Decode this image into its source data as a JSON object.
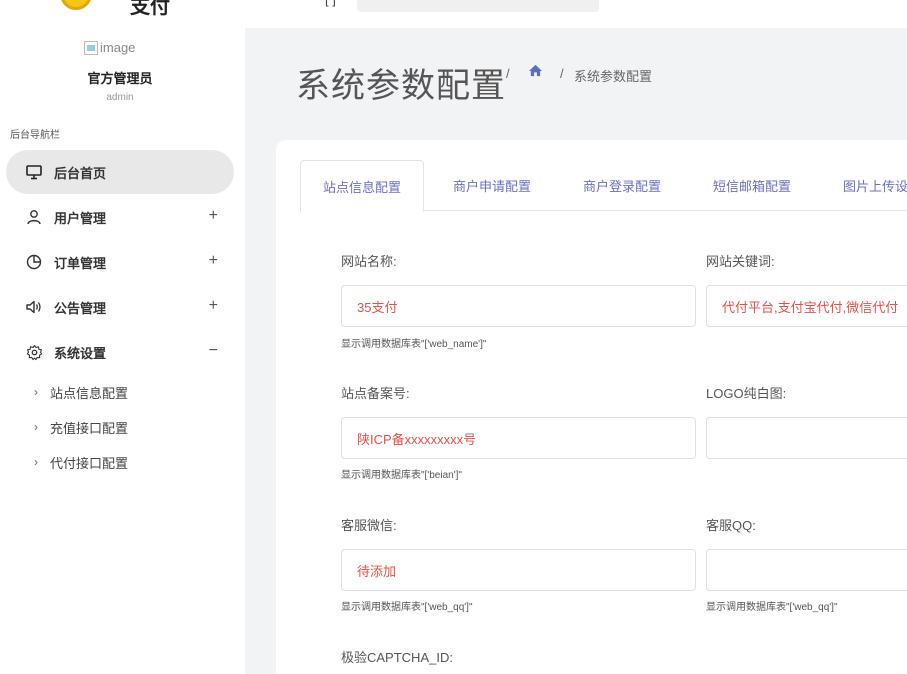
{
  "brand": {
    "name": "支付"
  },
  "user": {
    "avatar_alt": "image",
    "name": "官方管理员",
    "role": "admin"
  },
  "nav": {
    "caption": "后台导航栏",
    "items": [
      {
        "label": "后台首页",
        "icon": "monitor-icon",
        "expand": ""
      },
      {
        "label": "用户管理",
        "icon": "user-icon",
        "expand": "+"
      },
      {
        "label": "订单管理",
        "icon": "pie-chart-icon",
        "expand": "+"
      },
      {
        "label": "公告管理",
        "icon": "speaker-icon",
        "expand": "+"
      },
      {
        "label": "系统设置",
        "icon": "gear-icon",
        "expand": "−"
      }
    ],
    "sub_items": [
      {
        "label": "站点信息配置"
      },
      {
        "label": "充值接口配置"
      },
      {
        "label": "代付接口配置"
      }
    ]
  },
  "header": {
    "title": "系统参数配置",
    "breadcrumb_sep": "/",
    "breadcrumb_current": "系统参数配置"
  },
  "tabs": [
    {
      "label": "站点信息配置"
    },
    {
      "label": "商户申请配置"
    },
    {
      "label": "商户登录配置"
    },
    {
      "label": "短信邮箱配置"
    },
    {
      "label": "图片上传设置"
    }
  ],
  "form": {
    "site_name": {
      "label": "网站名称:",
      "value": "35支付",
      "hint": "显示调用数据库表\"['web_name']\""
    },
    "keywords": {
      "label": "网站关键词:",
      "value": "代付平台,支付宝代付,微信代付"
    },
    "beian": {
      "label": "站点备案号:",
      "value": "陕ICP备xxxxxxxxx号",
      "hint": "显示调用数据库表\"['beian']\""
    },
    "logo": {
      "label": "LOGO纯白图:",
      "value": ""
    },
    "wechat": {
      "label": "客服微信:",
      "value": "待添加",
      "hint": "显示调用数据库表\"['web_qq']\""
    },
    "qq": {
      "label": "客服QQ:",
      "value": "",
      "hint": "显示调用数据库表\"['web_qq']\""
    },
    "captcha": {
      "label": "极验CAPTCHA_ID:"
    }
  },
  "colors": {
    "accent": "#6b6fc7",
    "value_red": "#e8504a",
    "active_bg": "#e8e8e8"
  }
}
